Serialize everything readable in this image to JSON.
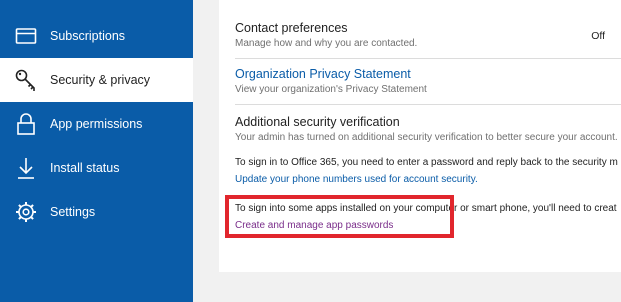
{
  "sidebar": {
    "items": [
      {
        "label": "Subscriptions",
        "icon": "card-icon",
        "active": false
      },
      {
        "label": "Security & privacy",
        "icon": "key-icon",
        "active": true
      },
      {
        "label": "App permissions",
        "icon": "lock-icon",
        "active": false
      },
      {
        "label": "Install status",
        "icon": "download-arrow-icon",
        "active": false
      },
      {
        "label": "Settings",
        "icon": "gear-icon",
        "active": false
      }
    ]
  },
  "content": {
    "contact": {
      "title": "Contact preferences",
      "description": "Manage how and why you are contacted.",
      "status": "Off"
    },
    "privacy": {
      "title": "Organization Privacy Statement",
      "description": "View your organization's Privacy Statement"
    },
    "security": {
      "title": "Additional security verification",
      "description": "Your admin has turned on additional security verification to better secure your account.",
      "sign_in_text": "To sign in to Office 365, you need to enter a password and reply back to the security m",
      "update_link": "Update your phone numbers used for account security.",
      "apps_text": "To sign into some apps installed on your computer or smart phone, you'll need to creat",
      "apps_link": "Create and manage app passwords"
    }
  },
  "colors": {
    "sidebar": "#0a5ca8",
    "link": "#0a5ca8",
    "visited_link": "#7a2d8a",
    "highlight": "#e1262d"
  }
}
